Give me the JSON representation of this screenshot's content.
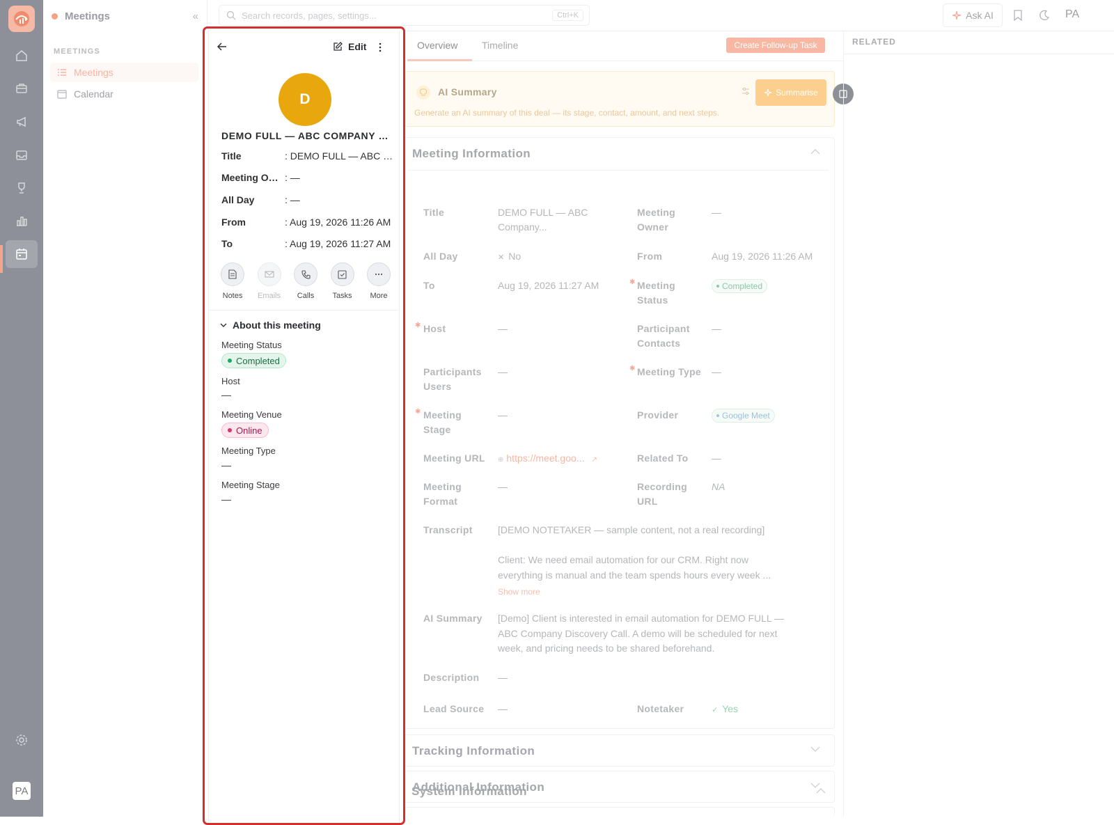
{
  "sidebar": {
    "module_title": "Meetings",
    "section_label": "MEETINGS",
    "items": [
      {
        "label": "Meetings",
        "icon": "list-icon",
        "active": true
      },
      {
        "label": "Calendar",
        "icon": "calendar-icon",
        "active": false
      }
    ]
  },
  "rail": {
    "avatar_initials": "PA",
    "icons": [
      "home-icon",
      "briefcase-icon",
      "megaphone-icon",
      "inbox-icon",
      "trophy-icon",
      "bar-chart-icon",
      "calendar-icon",
      "settings-icon"
    ]
  },
  "topbar": {
    "search_placeholder": "Search records, pages, settings...",
    "search_shortcut": "Ctrl+K",
    "ask_ai_label": "Ask AI",
    "user_initials": "PA"
  },
  "record_panel": {
    "edit_label": "Edit",
    "avatar_letter": "D",
    "record_name": "DEMO FULL — ABC COMPANY DISCOVERY CALL",
    "summary_fields": [
      {
        "key": "Title",
        "value": ": DEMO FULL — ABC Company Discovery Call"
      },
      {
        "key": "Meeting Owner",
        "value": ": —"
      },
      {
        "key": "All Day",
        "value": ": —"
      },
      {
        "key": "From",
        "value": ": Aug 19, 2026 11:26 AM"
      },
      {
        "key": "To",
        "value": ": Aug 19, 2026 11:27 AM"
      }
    ],
    "actions": [
      {
        "label": "Notes",
        "icon": "notes-icon",
        "enabled": true
      },
      {
        "label": "Emails",
        "icon": "email-icon",
        "enabled": false
      },
      {
        "label": "Calls",
        "icon": "phone-icon",
        "enabled": true
      },
      {
        "label": "Tasks",
        "icon": "task-icon",
        "enabled": true
      },
      {
        "label": "More",
        "icon": "more-icon",
        "enabled": true
      }
    ],
    "about_title": "About this meeting",
    "about_fields": [
      {
        "label": "Meeting Status",
        "value": "Completed"
      },
      {
        "label": "Host",
        "value": "—"
      },
      {
        "label": "Meeting Venue",
        "value": "Online"
      },
      {
        "label": "Meeting Type",
        "value": "—"
      },
      {
        "label": "Meeting Stage",
        "value": "—"
      }
    ]
  },
  "main": {
    "tabs": [
      "Overview",
      "Timeline"
    ],
    "active_tab": "Overview",
    "follow_up_button": "Create Follow-up Task",
    "ai_summary": {
      "title": "AI Summary",
      "description": "Generate an AI summary of this deal — its stage, contact, amount, and next steps.",
      "button": "Summarise"
    },
    "meeting_info": {
      "title": "Meeting Information",
      "fields": {
        "title_label": "Title",
        "title_value": "DEMO FULL — ABC Company...",
        "owner_label": "Meeting Owner",
        "owner_value": "—",
        "allday_label": "All Day",
        "allday_value": "No",
        "from_label": "From",
        "from_value": "Aug 19, 2026 11:26 AM",
        "to_label": "To",
        "to_value": "Aug 19, 2026 11:27 AM",
        "status_label": "Meeting Status",
        "status_value": "Completed",
        "host_label": "Host",
        "host_value": "—",
        "contacts_label": "Participant Contacts",
        "contacts_value": "—",
        "users_label": "Participants Users",
        "users_value": "—",
        "type_label": "Meeting Type",
        "type_value": "—",
        "stage_label": "Meeting Stage",
        "stage_value": "—",
        "provider_label": "Provider",
        "provider_value": "Google Meet",
        "url_label": "Meeting URL",
        "url_value": "https://meet.goo...",
        "related_label": "Related To",
        "related_value": "—",
        "format_label": "Meeting Format",
        "format_value": "—",
        "recording_label": "Recording URL",
        "recording_value": "NA",
        "transcript_label": "Transcript",
        "transcript_line1": "[DEMO NOTETAKER — sample content, not a real recording]",
        "transcript_line2": "Client: We need email automation for our CRM. Right now",
        "transcript_line3": "everything is manual and the team spends hours every week ...",
        "show_more": "Show more",
        "ai_summary_label": "AI Summary",
        "ai_summary_line1": "[Demo] Client is interested in email automation for DEMO FULL —",
        "ai_summary_line2": "ABC Company Discovery Call. A demo will be scheduled for next",
        "ai_summary_line3": "week, and pricing needs to be shared beforehand.",
        "description_label": "Description",
        "description_value": "—",
        "lead_source_label": "Lead Source",
        "lead_source_value": "—",
        "notetaker_label": "Notetaker",
        "notetaker_value": "Yes"
      }
    },
    "sections": [
      "Tracking Information",
      "Additional Information",
      "System Information"
    ]
  },
  "related": {
    "title": "RELATED"
  },
  "colors": {
    "accent": "#f4a287",
    "highlight_border": "#d32f2f",
    "avatar_bg": "#e8a70d",
    "completed_green": "#22a560",
    "online_pink": "#d6336c"
  }
}
